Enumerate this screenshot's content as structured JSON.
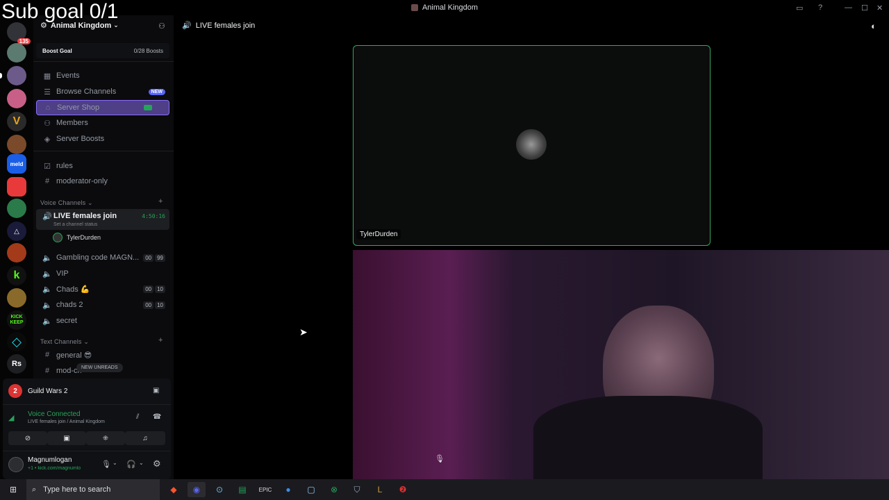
{
  "overlay": {
    "sub_goal": "Sub goal 0/1"
  },
  "window": {
    "title": "Animal Kingdom"
  },
  "server_bar": {
    "notif_count": "135",
    "items": [
      "kick-keep",
      "rs"
    ],
    "rs_label": "Rs",
    "meld_label": "meld",
    "kick_label": "KICK KEEP"
  },
  "server": {
    "name": "Animal Kingdom"
  },
  "boost": {
    "label": "Boost Goal",
    "count": "0/28 Boosts"
  },
  "nav": {
    "events": "Events",
    "browse": "Browse Channels",
    "browse_badge": "NEW",
    "shop": "Server Shop",
    "members": "Members",
    "boosts": "Server Boosts",
    "rules": "rules",
    "mod": "moderator-only"
  },
  "voice": {
    "category": "Voice Channels",
    "live": {
      "name": "LIVE females join",
      "timer": "4:50:16",
      "status": "Set a channel status",
      "user": "TylerDurden"
    },
    "gambling": {
      "name": "Gambling code MAGN...",
      "a": "00",
      "b": "99"
    },
    "vip": "VIP",
    "chads": {
      "name": "Chads 💪",
      "a": "00",
      "b": "10"
    },
    "chads2": {
      "name": "chads 2",
      "a": "00",
      "b": "10"
    },
    "secret": "secret"
  },
  "text": {
    "category": "Text Channels",
    "general": "general 😎",
    "modch": "mod-ch",
    "new_unreads": "NEW UNREADS"
  },
  "activity": {
    "game": "Guild Wars 2"
  },
  "connection": {
    "status": "Voice Connected",
    "detail": "LIVE females join / Animal Kingdom"
  },
  "user": {
    "name": "Magnumlogan",
    "status": "+1 • kick.com/magnumlo"
  },
  "header": {
    "channel": "LIVE females join"
  },
  "stage": {
    "tile1_name": "TylerDurden"
  },
  "taskbar": {
    "search_placeholder": "Type here to search"
  },
  "colors": {
    "accent": "#5865f2",
    "connected": "#23a55a",
    "tile_border": "#3ba55d"
  }
}
